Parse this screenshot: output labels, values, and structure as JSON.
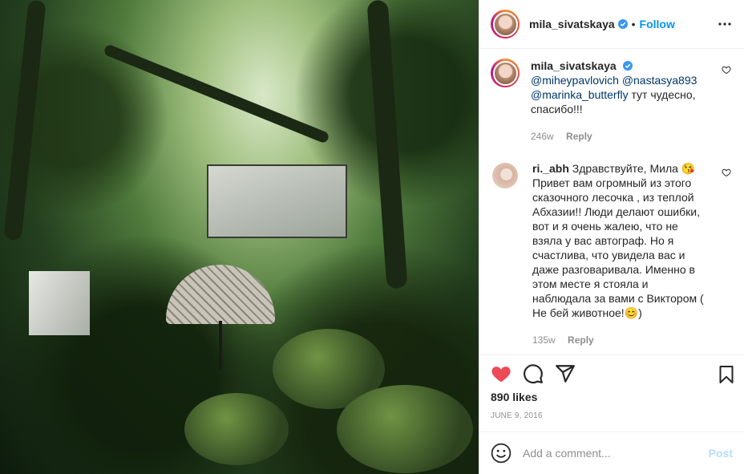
{
  "post": {
    "author": "mila_sivatskaya",
    "follow_label": "Follow",
    "separator": "•",
    "likes": "890 likes",
    "date": "JUNE 9, 2016"
  },
  "photo": {
    "alt": "Forest film set"
  },
  "comments": [
    {
      "user": "mila_sivatskaya",
      "verified": true,
      "mentions": [
        "@miheypavlovich",
        "@nastasya893",
        "@marinka_butterfly"
      ],
      "text": " тут чудесно, спасибо!!!",
      "age": "246w",
      "reply_label": "Reply"
    },
    {
      "user": "ri._abh",
      "text": "Здравствуйте, Мила 😘 Привет вам огромный из этого сказочного лесочка , из теплой Абхазии!! Люди делают ошибки, вот и я очень жалею, что не взяла у вас автограф. Но я счастлива, что увидела вас и даже разговаривала. Именно в этом месте я стояла и наблюдала за вами с Виктором ( Не бей животное!😊)",
      "age": "135w",
      "reply_label": "Reply"
    }
  ],
  "add_comment": {
    "placeholder": "Add a comment...",
    "post_label": "Post"
  },
  "colors": {
    "accent": "#0095f6",
    "like_red": "#ed4956",
    "post_disabled": "#b2dffc",
    "muted": "#8e8e8e"
  },
  "icons": {
    "verified": "verified-badge-icon",
    "more": "more-horizontal-icon",
    "like": "heart-filled-icon",
    "comment": "comment-bubble-icon",
    "share": "paper-plane-icon",
    "save": "bookmark-icon",
    "emoji": "smiley-icon"
  }
}
